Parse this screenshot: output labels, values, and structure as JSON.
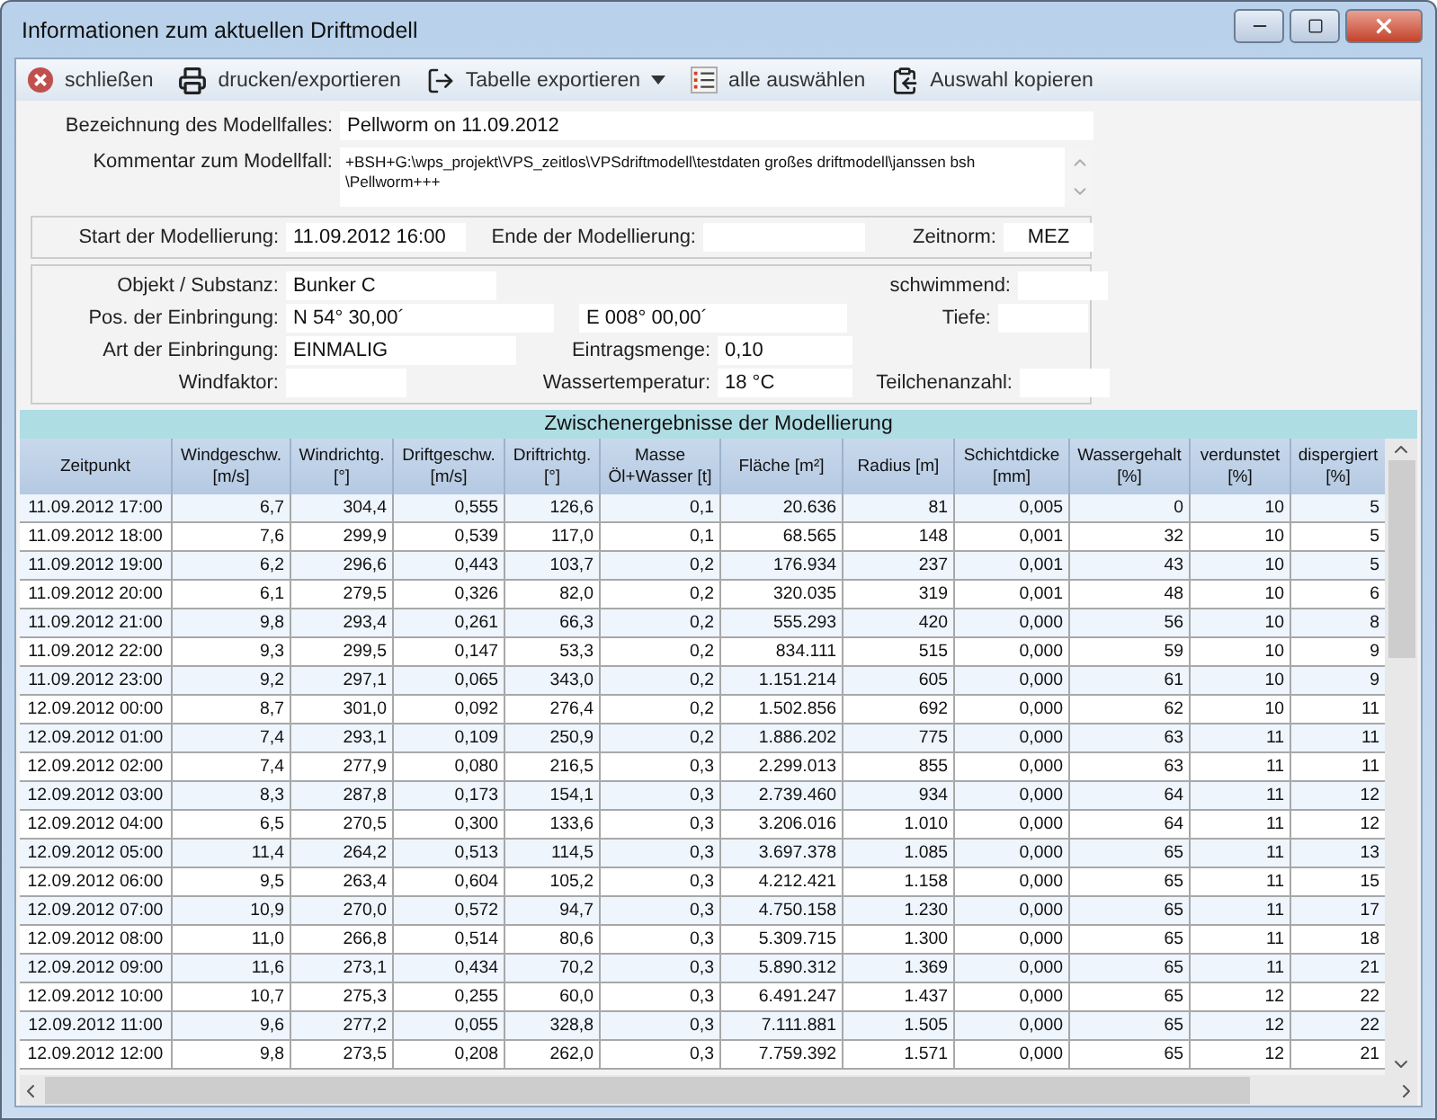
{
  "window": {
    "title": "Informationen zum aktuellen Driftmodell"
  },
  "toolbar": [
    {
      "kind": "close",
      "label": "schließen"
    },
    {
      "kind": "print",
      "label": "drucken/exportieren"
    },
    {
      "kind": "export",
      "label": "Tabelle exportieren",
      "dropdown": true
    },
    {
      "kind": "select",
      "label": "alle auswählen"
    },
    {
      "kind": "copy",
      "label": "Auswahl kopieren"
    }
  ],
  "model": {
    "name_label": "Bezeichnung des Modellfalles:",
    "name": "Pellworm on 11.09.2012",
    "comment_label": "Kommentar zum Modellfall:",
    "comment_lines": [
      "+BSH+G:\\wps_projekt\\VPS_zeitlos\\VPSdriftmodell\\testdaten großes driftmodell\\janssen bsh",
      "\\Pellworm+++"
    ]
  },
  "period": {
    "start_label": "Start der Modellierung:",
    "start": "11.09.2012 16:00",
    "end_label": "Ende der Modellierung:",
    "zone_label": "Zeitnorm:",
    "zone": "MEZ"
  },
  "substance": {
    "object_label": "Objekt / Substanz:",
    "object": "Bunker C",
    "floating_label": "schwimmend:",
    "position_label": "Pos. der Einbringung:",
    "lat": "N 54° 30,00´",
    "lon": "E 008° 00,00´",
    "depth_label": "Tiefe:",
    "type_label": "Art der Einbringung:",
    "type": "EINMALIG",
    "amount_label": "Eintragsmenge:",
    "amount": "0,10",
    "wind_label": "Windfaktor:",
    "water_temp_label": "Wassertemperatur:",
    "water_temp": "18 °C",
    "particles_label": "Teilchenanzahl:"
  },
  "results": {
    "title": "Zwischenergebnisse der Modellierung",
    "columns": [
      {
        "name": "Zeitpunkt"
      },
      {
        "name": "Windgeschw.",
        "unit": "[m/s]"
      },
      {
        "name": "Windrichtg.",
        "unit": "[°]"
      },
      {
        "name": "Driftgeschw.",
        "unit": "[m/s]"
      },
      {
        "name": "Driftrichtg.",
        "unit": "[°]"
      },
      {
        "name": "Masse",
        "unit": "Öl+Wasser [t]"
      },
      {
        "name": "Fläche [m²]"
      },
      {
        "name": "Radius [m]"
      },
      {
        "name": "Schichtdicke",
        "unit": "[mm]"
      },
      {
        "name": "Wassergehalt",
        "unit": "[%]"
      },
      {
        "name": "verdunstet",
        "unit": "[%]"
      },
      {
        "name": "dispergiert",
        "unit": "[%]"
      }
    ],
    "rows": [
      [
        "11.09.2012 17:00",
        "6,7",
        "304,4",
        "0,555",
        "126,6",
        "0,1",
        "20.636",
        "81",
        "0,005",
        "0",
        "10",
        "5"
      ],
      [
        "11.09.2012 18:00",
        "7,6",
        "299,9",
        "0,539",
        "117,0",
        "0,1",
        "68.565",
        "148",
        "0,001",
        "32",
        "10",
        "5"
      ],
      [
        "11.09.2012 19:00",
        "6,2",
        "296,6",
        "0,443",
        "103,7",
        "0,2",
        "176.934",
        "237",
        "0,001",
        "43",
        "10",
        "5"
      ],
      [
        "11.09.2012 20:00",
        "6,1",
        "279,5",
        "0,326",
        "82,0",
        "0,2",
        "320.035",
        "319",
        "0,001",
        "48",
        "10",
        "6"
      ],
      [
        "11.09.2012 21:00",
        "9,8",
        "293,4",
        "0,261",
        "66,3",
        "0,2",
        "555.293",
        "420",
        "0,000",
        "56",
        "10",
        "8"
      ],
      [
        "11.09.2012 22:00",
        "9,3",
        "299,5",
        "0,147",
        "53,3",
        "0,2",
        "834.111",
        "515",
        "0,000",
        "59",
        "10",
        "9"
      ],
      [
        "11.09.2012 23:00",
        "9,2",
        "297,1",
        "0,065",
        "343,0",
        "0,2",
        "1.151.214",
        "605",
        "0,000",
        "61",
        "10",
        "9"
      ],
      [
        "12.09.2012 00:00",
        "8,7",
        "301,0",
        "0,092",
        "276,4",
        "0,2",
        "1.502.856",
        "692",
        "0,000",
        "62",
        "10",
        "11"
      ],
      [
        "12.09.2012 01:00",
        "7,4",
        "293,1",
        "0,109",
        "250,9",
        "0,2",
        "1.886.202",
        "775",
        "0,000",
        "63",
        "11",
        "11"
      ],
      [
        "12.09.2012 02:00",
        "7,4",
        "277,9",
        "0,080",
        "216,5",
        "0,3",
        "2.299.013",
        "855",
        "0,000",
        "63",
        "11",
        "11"
      ],
      [
        "12.09.2012 03:00",
        "8,3",
        "287,8",
        "0,173",
        "154,1",
        "0,3",
        "2.739.460",
        "934",
        "0,000",
        "64",
        "11",
        "12"
      ],
      [
        "12.09.2012 04:00",
        "6,5",
        "270,5",
        "0,300",
        "133,6",
        "0,3",
        "3.206.016",
        "1.010",
        "0,000",
        "64",
        "11",
        "12"
      ],
      [
        "12.09.2012 05:00",
        "11,4",
        "264,2",
        "0,513",
        "114,5",
        "0,3",
        "3.697.378",
        "1.085",
        "0,000",
        "65",
        "11",
        "13"
      ],
      [
        "12.09.2012 06:00",
        "9,5",
        "263,4",
        "0,604",
        "105,2",
        "0,3",
        "4.212.421",
        "1.158",
        "0,000",
        "65",
        "11",
        "15"
      ],
      [
        "12.09.2012 07:00",
        "10,9",
        "270,0",
        "0,572",
        "94,7",
        "0,3",
        "4.750.158",
        "1.230",
        "0,000",
        "65",
        "11",
        "17"
      ],
      [
        "12.09.2012 08:00",
        "11,0",
        "266,8",
        "0,514",
        "80,6",
        "0,3",
        "5.309.715",
        "1.300",
        "0,000",
        "65",
        "11",
        "18"
      ],
      [
        "12.09.2012 09:00",
        "11,6",
        "273,1",
        "0,434",
        "70,2",
        "0,3",
        "5.890.312",
        "1.369",
        "0,000",
        "65",
        "11",
        "21"
      ],
      [
        "12.09.2012 10:00",
        "10,7",
        "275,3",
        "0,255",
        "60,0",
        "0,3",
        "6.491.247",
        "1.437",
        "0,000",
        "65",
        "12",
        "22"
      ],
      [
        "12.09.2012 11:00",
        "9,6",
        "277,2",
        "0,055",
        "328,8",
        "0,3",
        "7.111.881",
        "1.505",
        "0,000",
        "65",
        "12",
        "22"
      ],
      [
        "12.09.2012 12:00",
        "9,8",
        "273,5",
        "0,208",
        "262,0",
        "0,3",
        "7.759.392",
        "1.571",
        "0,000",
        "65",
        "12",
        "21"
      ]
    ]
  }
}
